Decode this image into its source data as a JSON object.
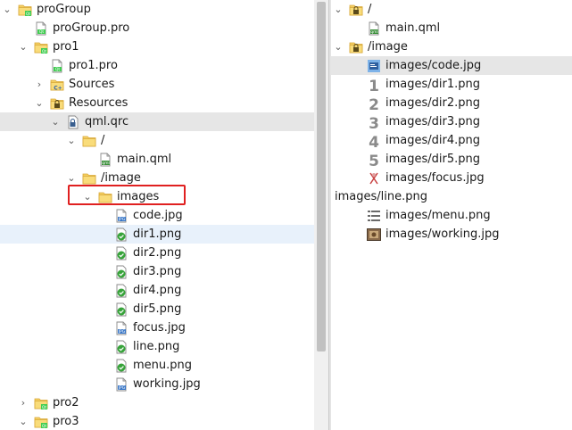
{
  "left_tree": [
    {
      "label": "proGroup",
      "icon": "qt-project-folder-icon",
      "depth": 0,
      "arrow": "down",
      "interactable": true
    },
    {
      "label": "proGroup.pro",
      "icon": "qt-pro-file-icon",
      "depth": 1,
      "arrow": "",
      "interactable": true
    },
    {
      "label": "pro1",
      "icon": "qt-project-folder-icon",
      "depth": 1,
      "arrow": "down",
      "interactable": true
    },
    {
      "label": "pro1.pro",
      "icon": "qt-pro-file-icon",
      "depth": 2,
      "arrow": "",
      "interactable": true
    },
    {
      "label": "Sources",
      "icon": "cpp-sources-folder-icon",
      "depth": 2,
      "arrow": "right",
      "interactable": true
    },
    {
      "label": "Resources",
      "icon": "locked-resources-folder-icon",
      "depth": 2,
      "arrow": "down",
      "interactable": true
    },
    {
      "label": "qml.qrc",
      "icon": "qrc-file-icon",
      "depth": 3,
      "arrow": "down",
      "interactable": true,
      "state": "selected"
    },
    {
      "label": "/",
      "icon": "folder-icon",
      "depth": 4,
      "arrow": "down",
      "interactable": true
    },
    {
      "label": "main.qml",
      "icon": "qml-file-icon",
      "depth": 5,
      "arrow": "",
      "interactable": true
    },
    {
      "label": "/image",
      "icon": "folder-icon",
      "depth": 4,
      "arrow": "down",
      "interactable": true
    },
    {
      "label": "images",
      "icon": "folder-icon",
      "depth": 5,
      "arrow": "down",
      "interactable": true
    },
    {
      "label": "code.jpg",
      "icon": "jpg-file-icon",
      "depth": 6,
      "arrow": "",
      "interactable": true
    },
    {
      "label": "dir1.png",
      "icon": "png-file-icon",
      "depth": 6,
      "arrow": "",
      "interactable": true,
      "state": "hover"
    },
    {
      "label": "dir2.png",
      "icon": "png-file-icon",
      "depth": 6,
      "arrow": "",
      "interactable": true
    },
    {
      "label": "dir3.png",
      "icon": "png-file-icon",
      "depth": 6,
      "arrow": "",
      "interactable": true
    },
    {
      "label": "dir4.png",
      "icon": "png-file-icon",
      "depth": 6,
      "arrow": "",
      "interactable": true
    },
    {
      "label": "dir5.png",
      "icon": "png-file-icon",
      "depth": 6,
      "arrow": "",
      "interactable": true
    },
    {
      "label": "focus.jpg",
      "icon": "jpg-file-icon",
      "depth": 6,
      "arrow": "",
      "interactable": true
    },
    {
      "label": "line.png",
      "icon": "png-file-icon",
      "depth": 6,
      "arrow": "",
      "interactable": true
    },
    {
      "label": "menu.png",
      "icon": "png-file-icon",
      "depth": 6,
      "arrow": "",
      "interactable": true
    },
    {
      "label": "working.jpg",
      "icon": "jpg-file-icon",
      "depth": 6,
      "arrow": "",
      "interactable": true
    },
    {
      "label": "pro2",
      "icon": "qt-project-folder-icon",
      "depth": 1,
      "arrow": "right",
      "interactable": true
    },
    {
      "label": "pro3",
      "icon": "qt-project-folder-icon",
      "depth": 1,
      "arrow": "down",
      "interactable": true
    }
  ],
  "right_tree": [
    {
      "label": "/",
      "icon": "locked-folder-icon",
      "depth": 0,
      "arrow": "down",
      "interactable": true
    },
    {
      "label": "main.qml",
      "icon": "qml-file-icon",
      "depth": 1,
      "arrow": "",
      "interactable": true
    },
    {
      "label": "/image",
      "icon": "locked-folder-icon",
      "depth": 0,
      "arrow": "down",
      "interactable": true
    },
    {
      "label": "images/code.jpg",
      "icon": "code-image-icon",
      "depth": 1,
      "arrow": "",
      "interactable": true,
      "state": "selected"
    },
    {
      "label": "images/dir1.png",
      "icon": "digit-1-icon",
      "depth": 1,
      "arrow": "",
      "interactable": true
    },
    {
      "label": "images/dir2.png",
      "icon": "digit-2-icon",
      "depth": 1,
      "arrow": "",
      "interactable": true
    },
    {
      "label": "images/dir3.png",
      "icon": "digit-3-icon",
      "depth": 1,
      "arrow": "",
      "interactable": true
    },
    {
      "label": "images/dir4.png",
      "icon": "digit-4-icon",
      "depth": 1,
      "arrow": "",
      "interactable": true
    },
    {
      "label": "images/dir5.png",
      "icon": "digit-5-icon",
      "depth": 1,
      "arrow": "",
      "interactable": true
    },
    {
      "label": "images/focus.jpg",
      "icon": "focus-image-icon",
      "depth": 1,
      "arrow": "",
      "interactable": true
    },
    {
      "label": "images/line.png",
      "icon": "",
      "depth": 0,
      "arrow": "",
      "interactable": true
    },
    {
      "label": "images/menu.png",
      "icon": "menu-list-icon",
      "depth": 1,
      "arrow": "",
      "interactable": true
    },
    {
      "label": "images/working.jpg",
      "icon": "working-photo-icon",
      "depth": 1,
      "arrow": "",
      "interactable": true
    }
  ],
  "scrollbar": {
    "visible_fraction": 0.82
  },
  "colors": {
    "folder": "#f5cf62",
    "qt_green": "#41cd52",
    "jpg_blue": "#3a78c8",
    "png_green": "#37a33a",
    "highlight": "#e02020",
    "selected_bg": "#e6e6e6",
    "hover_bg": "#e8f1fb"
  }
}
